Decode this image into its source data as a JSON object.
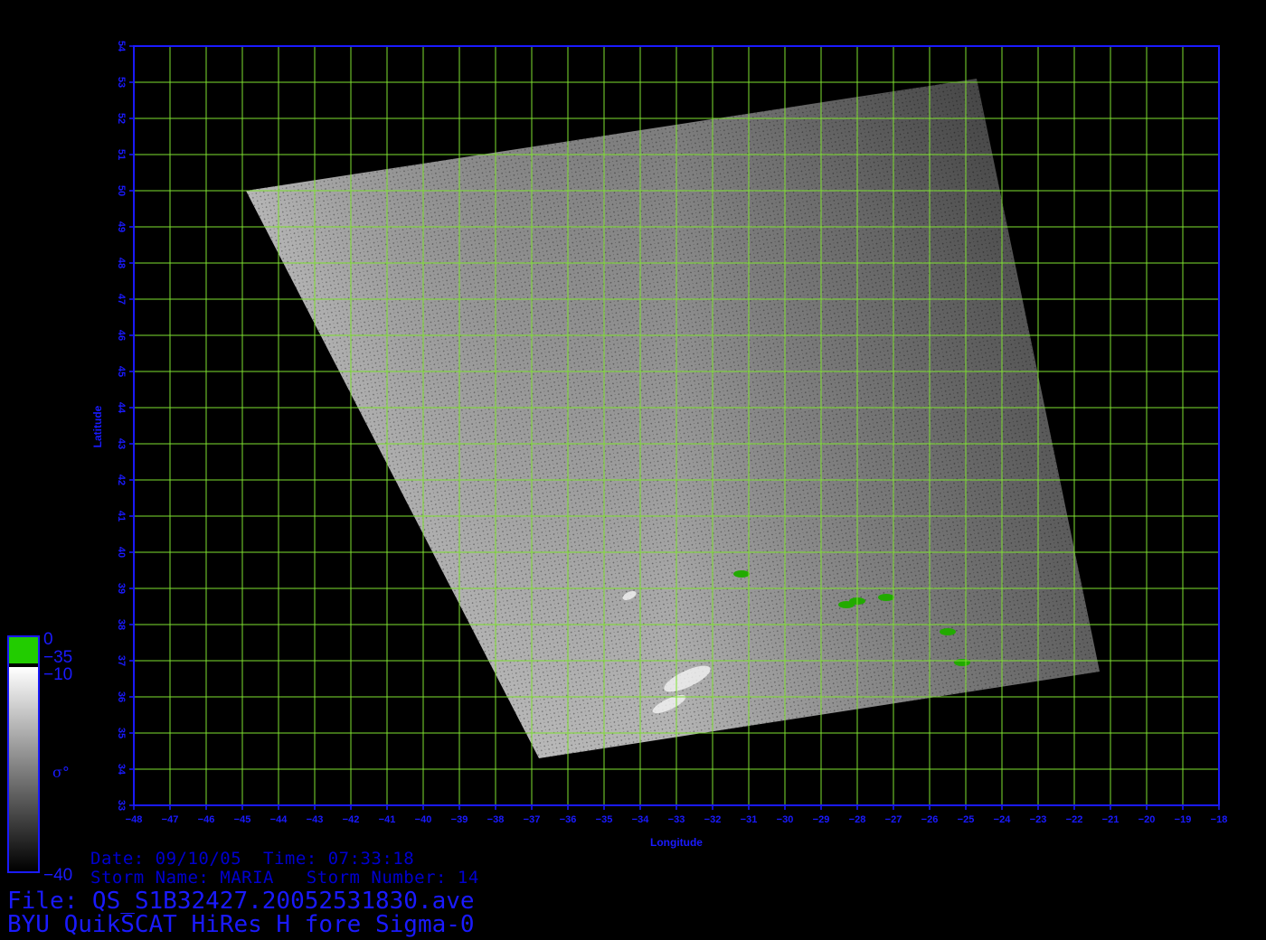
{
  "map": {
    "xlabel": "Longitude",
    "ylabel": "Latitude",
    "lon_range": [
      -48,
      -18
    ],
    "lat_range": [
      33,
      54
    ],
    "lon_ticks": [
      -48,
      -47,
      -46,
      -45,
      -44,
      -43,
      -42,
      -41,
      -40,
      -39,
      -38,
      -37,
      -36,
      -35,
      -34,
      -33,
      -32,
      -31,
      -30,
      -29,
      -28,
      -27,
      -26,
      -25,
      -24,
      -23,
      -22,
      -21,
      -20,
      -19,
      -18
    ],
    "lat_ticks": [
      33,
      34,
      35,
      36,
      37,
      38,
      39,
      40,
      41,
      42,
      43,
      44,
      45,
      46,
      47,
      48,
      49,
      50,
      51,
      52,
      53,
      54
    ],
    "grid": true,
    "grid_color": "#7ee030",
    "axis_color": "#1a1aff",
    "land_color": "#22aa00",
    "swath_corners_lonlat": [
      [
        -44.9,
        50.0
      ],
      [
        -24.7,
        53.1
      ],
      [
        -21.3,
        36.7
      ],
      [
        -36.8,
        34.3
      ]
    ],
    "land_patches_lonlat": [
      {
        "name": "flores",
        "lon": -31.2,
        "lat": 39.4
      },
      {
        "name": "terceira",
        "lon": -27.2,
        "lat": 38.75
      },
      {
        "name": "sao-jorge",
        "lon": -28.0,
        "lat": 38.65
      },
      {
        "name": "pico",
        "lon": -28.3,
        "lat": 38.55
      },
      {
        "name": "sao-miguel",
        "lon": -25.5,
        "lat": 37.8
      },
      {
        "name": "santa-maria",
        "lon": -25.1,
        "lat": 36.95
      }
    ]
  },
  "colorbar": {
    "label_top": "0",
    "label_green_bottom": "−35",
    "label_gray_top": "−10",
    "label_bottom": "−40",
    "quantity": "σ°",
    "green_color": "#22cc00",
    "frame_color": "#1a1aff"
  },
  "info": {
    "line1": "Date: 09/10/05  Time: 07:33:18",
    "line2": "Storm Name: MARIA   Storm Number: 14",
    "file_line": "File: QS_S1B32427.20052531830.ave",
    "product_line": "BYU QuikSCAT HiRes H fore Sigma-0"
  }
}
